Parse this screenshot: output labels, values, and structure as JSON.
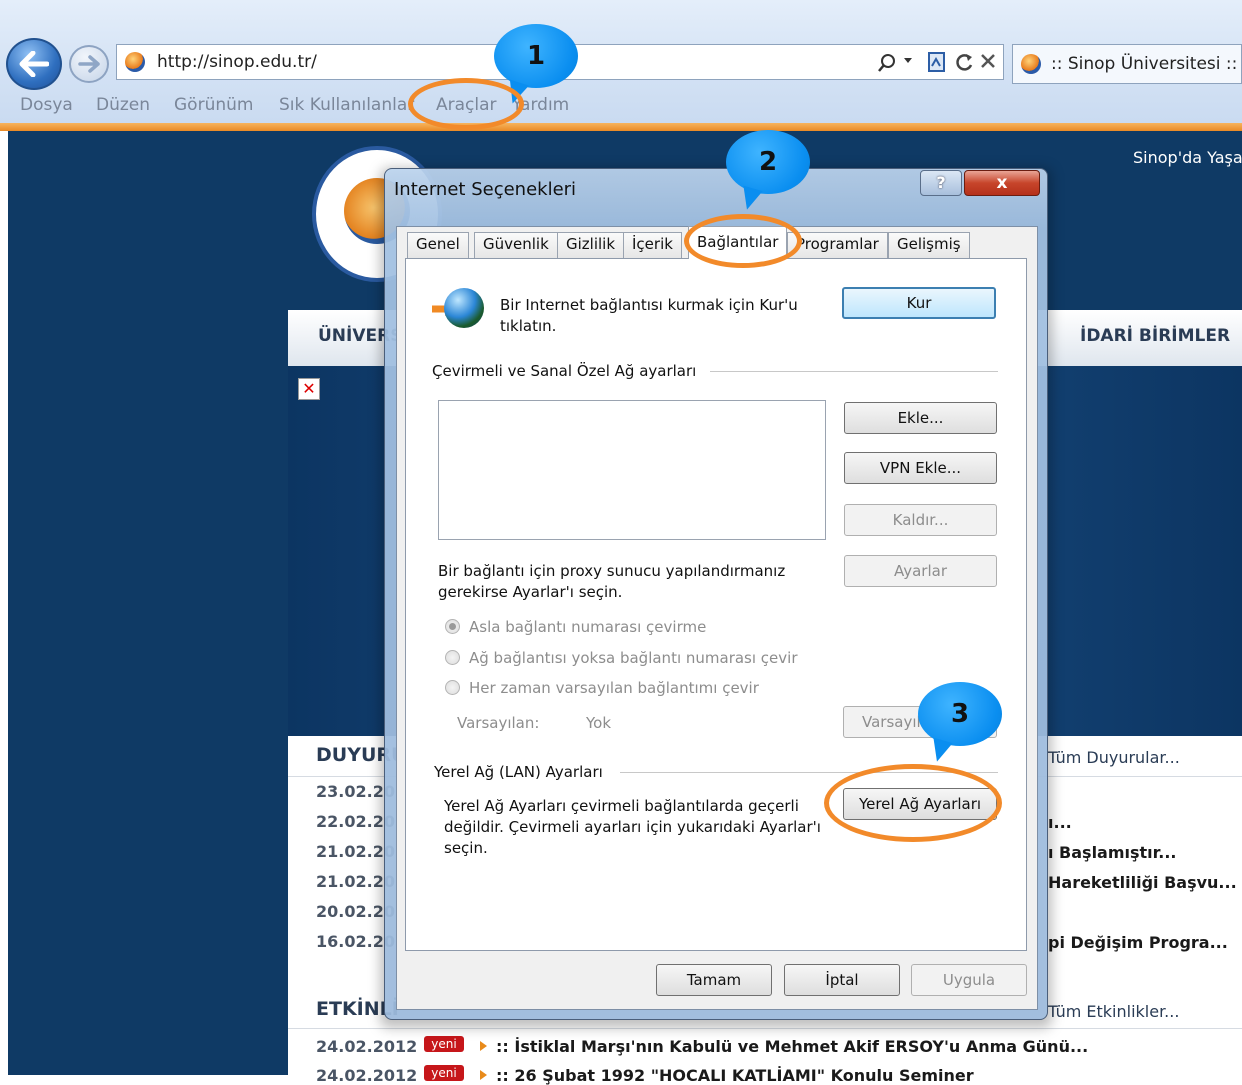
{
  "browser": {
    "url": "http://sinop.edu.tr/",
    "tab_title": ":: Sinop Üniversitesi ::",
    "menu": [
      "Dosya",
      "Düzen",
      "Görünüm",
      "Sık Kullanılanlar",
      "Araçlar",
      "Yardım"
    ]
  },
  "site": {
    "header_right": "Sinop'da Yaşa",
    "nav_left": "ÜNİVERS",
    "nav_right": "İDARİ BİRİMLER",
    "duyurular": {
      "title": "DUYURU",
      "all_link": "Tüm Duyurular...",
      "dates": [
        "23.02.20",
        "22.02.20",
        "21.02.20",
        "21.02.20",
        "20.02.20",
        "16.02.20"
      ],
      "right_texts": [
        "",
        "ı...",
        "ı Başlamıştır...",
        "Hareketliliği Başvu...",
        "",
        "pi Değişim Progra..."
      ]
    },
    "etkinlikler": {
      "title": "ETKİNLİ",
      "all_link": "Tüm Etkinlikler...",
      "items": [
        {
          "date": "24.02.2012",
          "badge": "yeni",
          "text": ":: İstiklal Marşı'nın Kabulü ve Mehmet Akif ERSOY'u Anma Günü..."
        },
        {
          "date": "24.02.2012",
          "badge": "yeni",
          "text": ":: 26 Şubat 1992 \"HOCALI KATLİAMI\" Konulu Seminer"
        }
      ]
    }
  },
  "dialog": {
    "title": "Internet Seçenekleri",
    "help": "?",
    "close": "x",
    "tabs": [
      "Genel",
      "Güvenlik",
      "Gizlilik",
      "İçerik",
      "Bağlantılar",
      "Programlar",
      "Gelişmiş"
    ],
    "setup_text": "Bir Internet bağlantısı kurmak için Kur'u tıklatın.",
    "setup_button": "Kur",
    "dialup_group": "Çevirmeli ve Sanal Özel Ağ ayarları",
    "add_button": "Ekle...",
    "add_vpn_button": "VPN Ekle...",
    "remove_button": "Kaldır...",
    "settings_button": "Ayarlar",
    "proxy_text": "Bir bağlantı için proxy sunucu yapılandırmanız gerekirse Ayarlar'ı seçin.",
    "radios": [
      "Asla bağlantı numarası çevirme",
      "Ağ bağlantısı yoksa bağlantı numarası çevir",
      "Her zaman varsayılan bağlantımı çevir"
    ],
    "default_label": "Varsayılan:",
    "default_value": "Yok",
    "set_default_button": "Varsayılan",
    "lan_group": "Yerel Ağ (LAN) Ayarları",
    "lan_text": "Yerel Ağ Ayarları çevirmeli bağlantılarda geçerli değildir. Çevirmeli ayarları için yukarıdaki Ayarlar'ı seçin.",
    "lan_button": "Yerel Ağ Ayarları",
    "ok_button": "Tamam",
    "cancel_button": "İptal",
    "apply_button": "Uygula"
  },
  "annotations": [
    "1",
    "2",
    "3"
  ],
  "colors": {
    "accent_orange": "#f28a2a",
    "bubble_blue": "#0a8ef0",
    "site_navy": "#0f3a65"
  }
}
